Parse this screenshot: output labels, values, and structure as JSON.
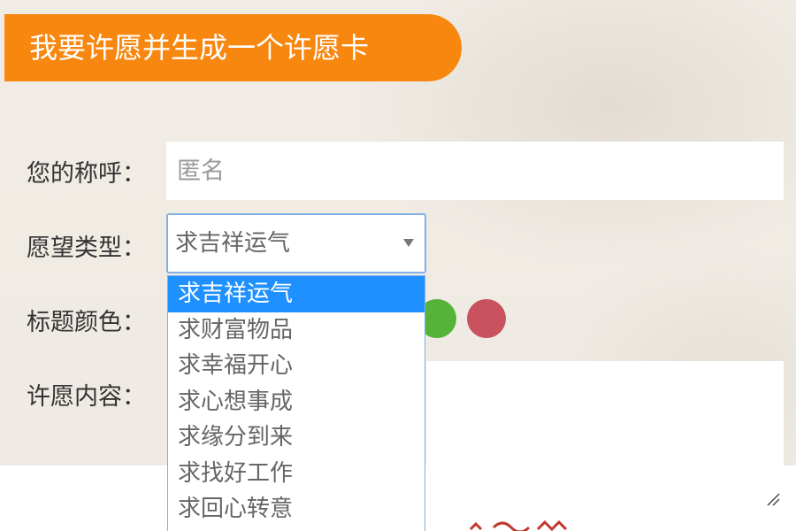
{
  "header": {
    "title": "我要许愿并生成一个许愿卡"
  },
  "form": {
    "name_label": "您的称呼：",
    "name_placeholder": "匿名",
    "type_label": "愿望类型：",
    "type_selected": "求吉祥运气",
    "type_options": [
      "求吉祥运气",
      "求财富物品",
      "求幸福开心",
      "求心想事成",
      "求缘分到来",
      "求找好工作",
      "求回心转意"
    ],
    "color_label": "标题颜色：",
    "color_options": [
      "#55b33a",
      "#c8525e"
    ],
    "content_label": "许愿内容："
  }
}
